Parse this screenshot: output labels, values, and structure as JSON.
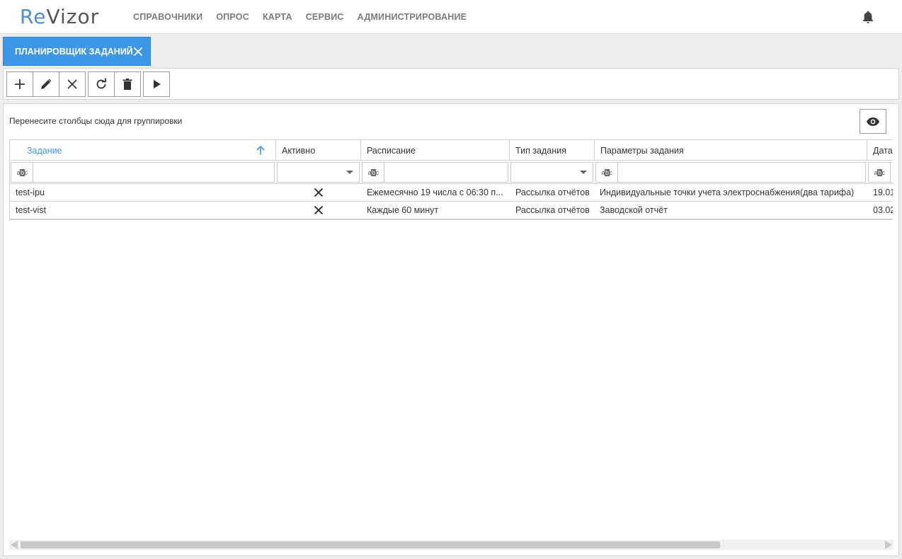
{
  "app": {
    "logo_re": "Re",
    "logo_vizor": "Vizor"
  },
  "nav": {
    "items": [
      {
        "label": "СПРАВОЧНИКИ"
      },
      {
        "label": "ОПРОС"
      },
      {
        "label": "КАРТА"
      },
      {
        "label": "СЕРВИС"
      },
      {
        "label": "АДМИНИСТРИРОВАНИЕ"
      }
    ]
  },
  "tab": {
    "label": "ПЛАНИРОВЩИК ЗАДАНИЙ"
  },
  "toolbar": {
    "icons": [
      "plus-icon",
      "pencil-icon",
      "close-icon",
      "refresh-icon",
      "trash-icon",
      "play-icon"
    ]
  },
  "grid": {
    "group_hint": "Перенесите столбцы сюда для группировки",
    "columns": [
      {
        "label": "Задание"
      },
      {
        "label": "Активно"
      },
      {
        "label": "Расписание"
      },
      {
        "label": "Тип задания"
      },
      {
        "label": "Параметры задания"
      },
      {
        "label": "Дата"
      }
    ],
    "rows": [
      {
        "name": "test-ipu",
        "active": false,
        "schedule": "Ежемесячно 19 числа с 06:30 п...",
        "type": "Рассылка отчётов",
        "params": "Индивидуальные точки учета электроснабжения(два тарифа)",
        "date": "19.01"
      },
      {
        "name": "test-vist",
        "active": false,
        "schedule": "Каждые 60 минут",
        "type": "Рассылка отчётов",
        "params": "Заводской отчёт",
        "date": "03.02"
      }
    ]
  },
  "colors": {
    "accent": "#3d97e6",
    "logo_accent": "#4a8fd3"
  }
}
